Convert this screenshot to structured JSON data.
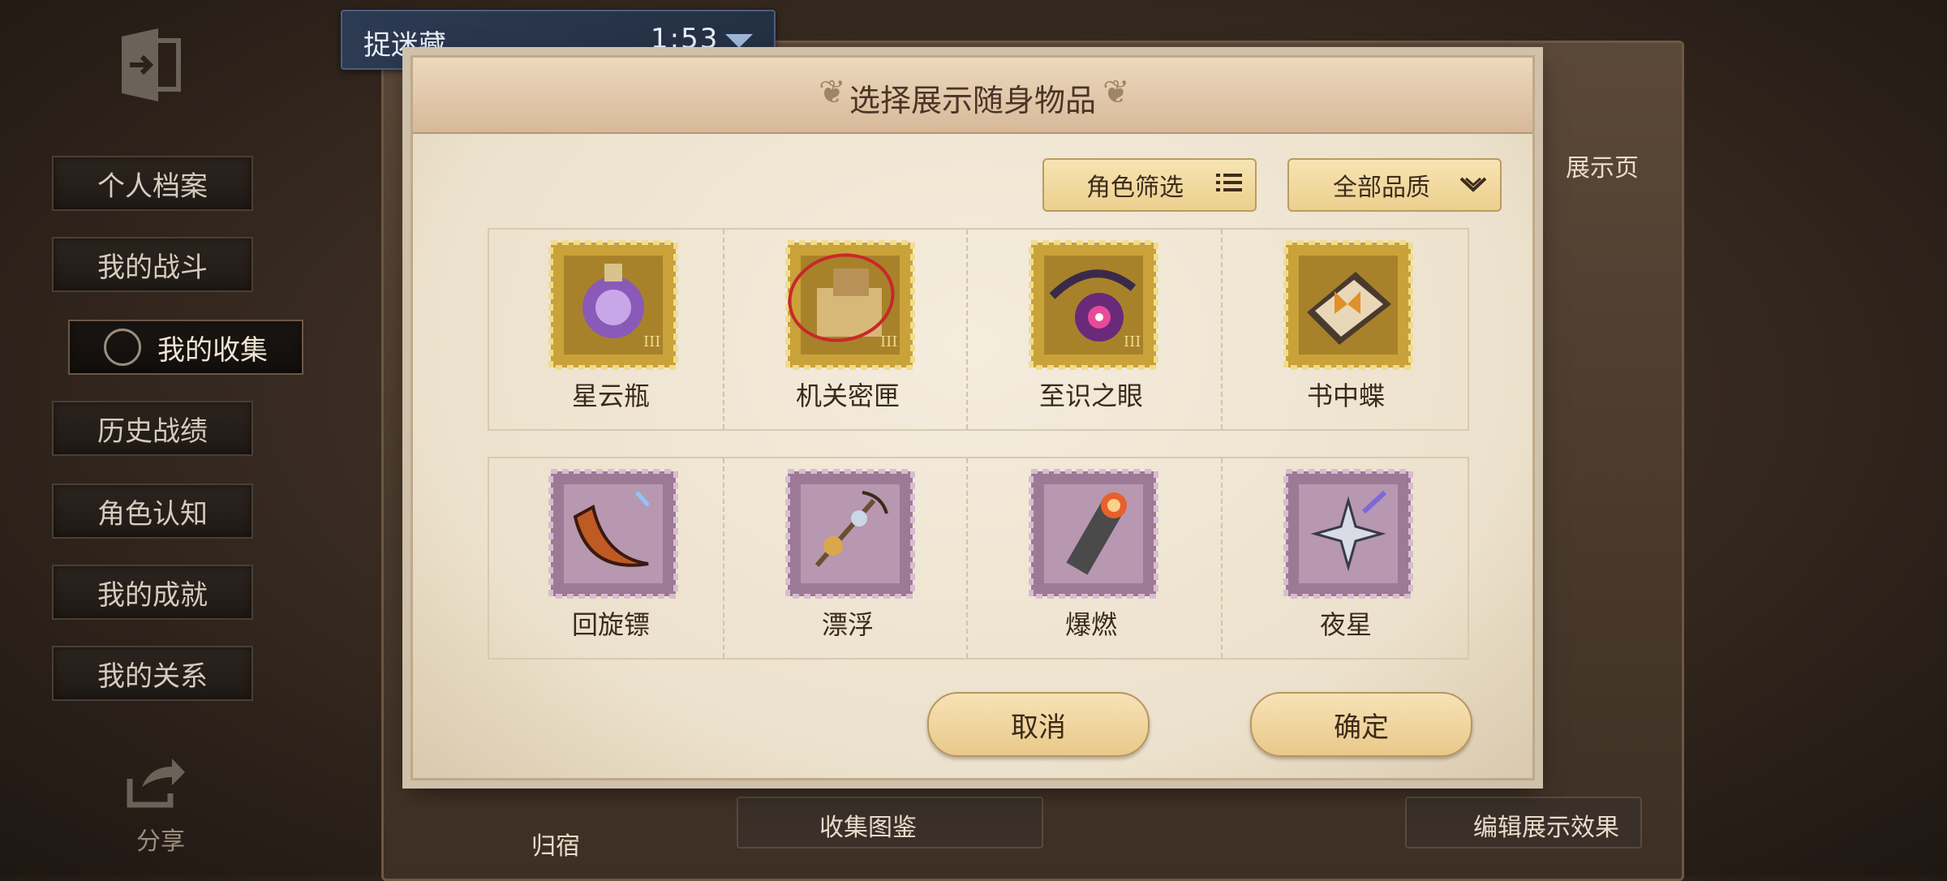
{
  "mode": {
    "name": "捉迷藏",
    "time": "1:53"
  },
  "modal": {
    "title": "选择展示随身物品",
    "filter_character": "角色筛选",
    "filter_quality": "全部品质",
    "cancel": "取消",
    "confirm": "确定"
  },
  "items": [
    {
      "name": "星云瓶",
      "quality": "gold",
      "icon": "nebula-bottle-icon"
    },
    {
      "name": "机关密匣",
      "quality": "gold",
      "icon": "mechanism-box-icon"
    },
    {
      "name": "至识之眼",
      "quality": "gold",
      "icon": "eye-of-knowledge-icon"
    },
    {
      "name": "书中蝶",
      "quality": "gold",
      "icon": "book-butterfly-icon"
    },
    {
      "name": "回旋镖",
      "quality": "purple",
      "icon": "boomerang-icon"
    },
    {
      "name": "漂浮",
      "quality": "purple",
      "icon": "float-icon"
    },
    {
      "name": "爆燃",
      "quality": "purple",
      "icon": "deflagration-icon"
    },
    {
      "name": "夜星",
      "quality": "purple",
      "icon": "night-star-icon"
    }
  ],
  "sidebar": {
    "items": [
      {
        "label": "个人档案"
      },
      {
        "label": "我的战斗"
      },
      {
        "label": "我的收集"
      },
      {
        "label": "历史战绩"
      },
      {
        "label": "角色认知"
      },
      {
        "label": "我的成就"
      },
      {
        "label": "我的关系"
      }
    ],
    "share": "分享"
  },
  "background": {
    "show_page": "展示页",
    "home": "归宿",
    "collection_atlas": "收集图鉴",
    "edit_display": "编辑展示效果"
  },
  "colors": {
    "gold_stamp": "#c9a23a",
    "purple_stamp": "#9c7a96",
    "accent": "#eccf8d"
  }
}
